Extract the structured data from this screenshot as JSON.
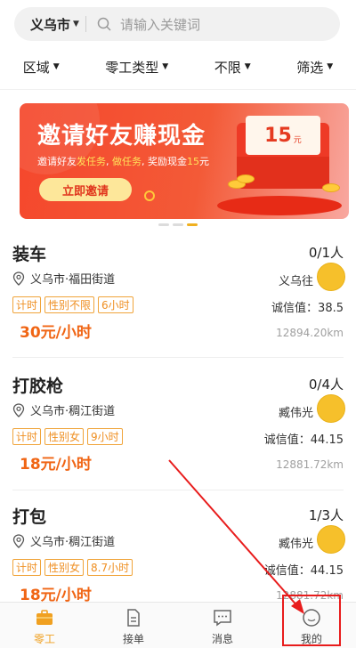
{
  "search": {
    "city": "义乌市",
    "placeholder": "请输入关键词"
  },
  "filters": [
    "区域",
    "零工类型",
    "不限",
    "筛选"
  ],
  "banner": {
    "title": "邀请好友赚现金",
    "subtitle_prefix": "邀请好友",
    "subtitle_hl1": "发任务",
    "subtitle_sep": ", ",
    "subtitle_hl2": "做任务",
    "subtitle_suffix": ", 奖励现金",
    "subtitle_amount": "15",
    "subtitle_unit": "元",
    "cta": "立即邀请",
    "envelope_amount": "15",
    "envelope_unit": "元"
  },
  "jobs": [
    {
      "name": "装车",
      "count": "0/1人",
      "location": "义乌市·福田街道",
      "poster": "义乌往",
      "tags": [
        "计时",
        "性别不限",
        "6小时"
      ],
      "credit": "诚信值：38.5",
      "pay": "30元/小时",
      "distance": "12894.20km"
    },
    {
      "name": "打胶枪",
      "count": "0/4人",
      "location": "义乌市·稠江街道",
      "poster": "臧伟光",
      "tags": [
        "计时",
        "性别女",
        "9小时"
      ],
      "credit": "诚信值：44.15",
      "pay": "18元/小时",
      "distance": "12881.72km"
    },
    {
      "name": "打包",
      "count": "1/3人",
      "location": "义乌市·稠江街道",
      "poster": "臧伟光",
      "tags": [
        "计时",
        "性别女",
        "8.7小时"
      ],
      "credit": "诚信值：44.15",
      "pay": "18元/小时",
      "distance": "12881.72km"
    }
  ],
  "bottom_nav": {
    "items": [
      {
        "label": "零工",
        "icon": "briefcase-icon",
        "active": true
      },
      {
        "label": "接单",
        "icon": "document-icon",
        "active": false
      },
      {
        "label": "消息",
        "icon": "chat-icon",
        "active": false
      },
      {
        "label": "我的",
        "icon": "profile-icon",
        "active": false
      }
    ]
  },
  "colors": {
    "accent": "#f0a020",
    "pay": "#f06514",
    "tag": "#ef8f22",
    "banner": "#f5472c",
    "annotation": "#e81c1c"
  }
}
